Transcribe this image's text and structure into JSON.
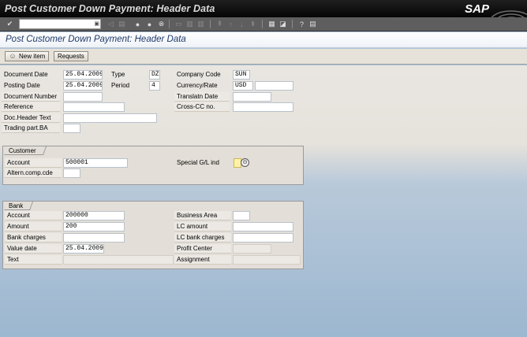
{
  "window": {
    "title": "Post Customer Down Payment: Header Data",
    "brand": "SAP"
  },
  "toolbar": {
    "command_field": ""
  },
  "screen": {
    "title": "Post Customer Down Payment: Header Data"
  },
  "app_toolbar": {
    "new_item": "New item",
    "requests": "Requests"
  },
  "header": {
    "document_date": {
      "label": "Document Date",
      "value": "25.04.2009"
    },
    "type": {
      "label": "Type",
      "value": "DZ"
    },
    "company_code": {
      "label": "Company Code",
      "value": "SUN"
    },
    "posting_date": {
      "label": "Posting Date",
      "value": "25.04.2009"
    },
    "period": {
      "label": "Period",
      "value": "4"
    },
    "currency_rate": {
      "label": "Currency/Rate",
      "value": "USD",
      "rate": ""
    },
    "document_number": {
      "label": "Document Number",
      "value": ""
    },
    "translatn_date": {
      "label": "Translatn Date",
      "value": ""
    },
    "reference": {
      "label": "Reference",
      "value": ""
    },
    "cross_cc_no": {
      "label": "Cross-CC no.",
      "value": ""
    },
    "doc_header_text": {
      "label": "Doc.Header Text",
      "value": ""
    },
    "trading_part_ba": {
      "label": "Trading part.BA",
      "value": ""
    }
  },
  "customer": {
    "group_title": "Customer",
    "account": {
      "label": "Account",
      "value": "500001"
    },
    "special_gl_ind": {
      "label": "Special G/L ind",
      "value": ""
    },
    "altern_comp_cde": {
      "label": "Altern.comp.cde",
      "value": ""
    }
  },
  "bank": {
    "group_title": "Bank",
    "account": {
      "label": "Account",
      "value": "200000"
    },
    "business_area": {
      "label": "Business Area",
      "value": ""
    },
    "amount": {
      "label": "Amount",
      "value": "200"
    },
    "lc_amount": {
      "label": "LC amount",
      "value": ""
    },
    "bank_charges": {
      "label": "Bank charges",
      "value": ""
    },
    "lc_bank_charges": {
      "label": "LC bank charges",
      "value": ""
    },
    "value_date": {
      "label": "Value date",
      "value": "25.04.2009"
    },
    "profit_center": {
      "label": "Profit Center",
      "value": ""
    },
    "text": {
      "label": "Text",
      "value": ""
    },
    "assignment": {
      "label": "Assignment",
      "value": ""
    }
  }
}
